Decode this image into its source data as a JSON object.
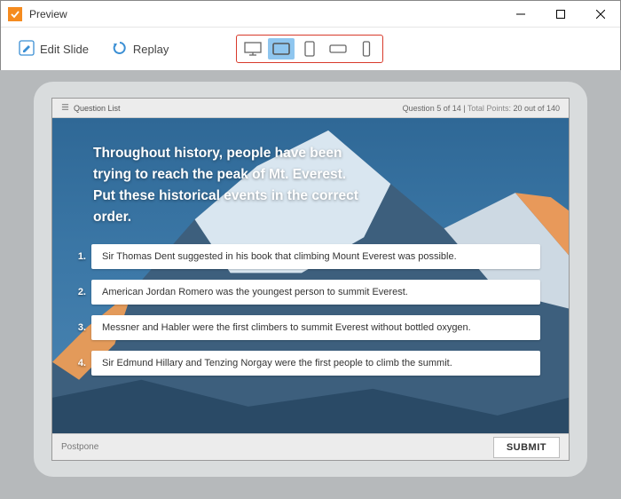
{
  "window": {
    "title": "Preview"
  },
  "toolbar": {
    "edit_slide": "Edit Slide",
    "replay": "Replay"
  },
  "slide": {
    "question_list_label": "Question List",
    "meta_question": "Question 5 of 14",
    "meta_sep": "   |   ",
    "meta_points_label": "Total Points: ",
    "meta_points_value": "20 out of 140",
    "question_text": "Throughout history, people have been trying to reach the peak of Mt. Everest. Put these historical events in the correct order.",
    "answers": [
      {
        "num": "1.",
        "text": "Sir Thomas Dent suggested in his book that climbing Mount Everest was possible."
      },
      {
        "num": "2.",
        "text": "American Jordan Romero was the youngest person to summit Everest."
      },
      {
        "num": "3.",
        "text": "Messner and Habler were the first climbers to summit Everest without bottled oxygen."
      },
      {
        "num": "4.",
        "text": "Sir Edmund Hillary and Tenzing Norgay were the first people to climb the summit."
      }
    ],
    "postpone": "Postpone",
    "submit": "SUBMIT"
  }
}
